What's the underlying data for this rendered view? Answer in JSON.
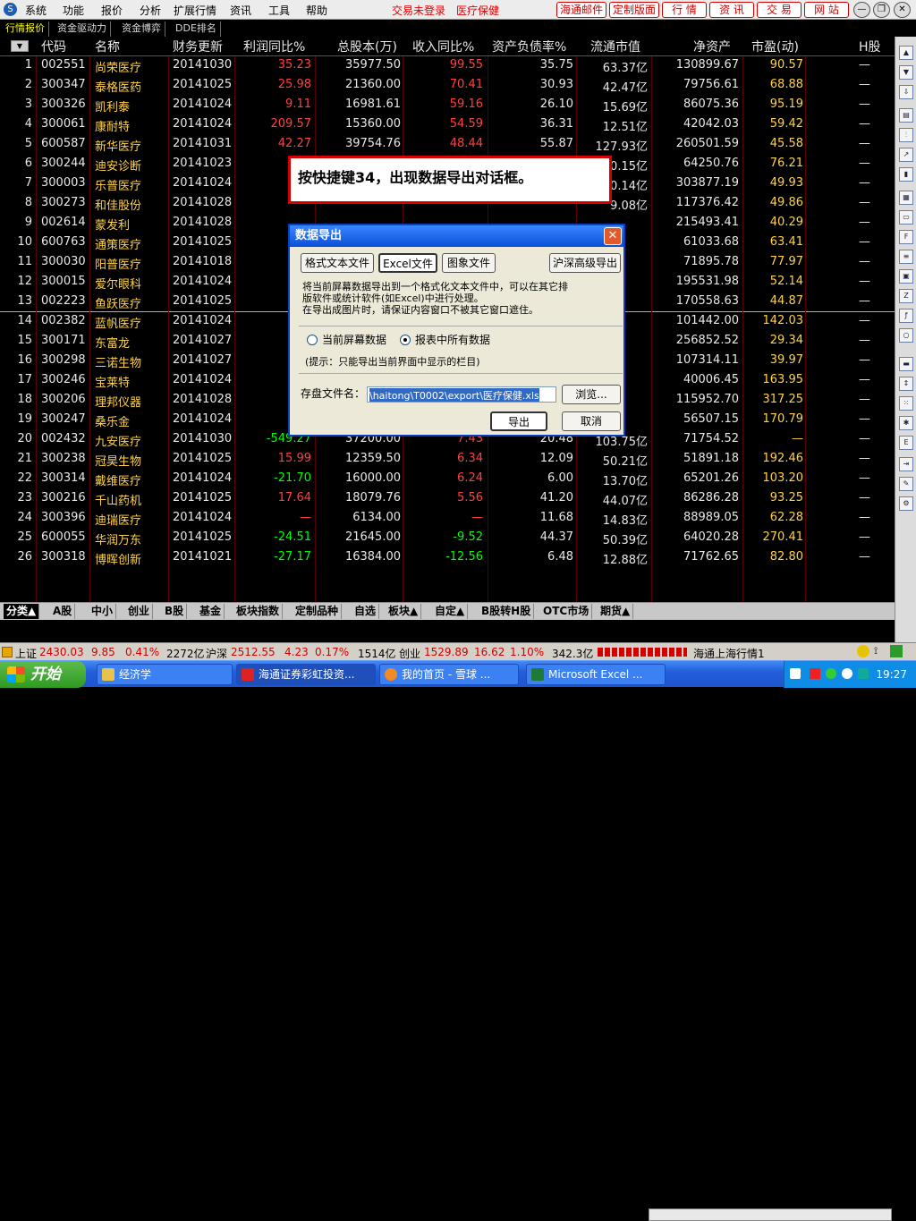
{
  "menubar": {
    "logo": "S",
    "items": [
      "系统",
      "功能",
      "报价",
      "分析",
      "扩展行情",
      "资讯",
      "工具",
      "帮助"
    ],
    "login_status": "交易未登录",
    "sector": "医疗保健",
    "toolbar": [
      "海通邮件",
      "定制版面",
      "行 情",
      "资 讯",
      "交 易",
      "网 站"
    ]
  },
  "subtabs": [
    "行情报价",
    "资金驱动力",
    "资金博弈",
    "DDE排名"
  ],
  "columns": [
    "代码",
    "名称",
    "财务更新",
    "利润同比%",
    "总股本(万)",
    "收入同比%",
    "资产负债率%",
    "流通市值",
    "净资产",
    "市盈(动)",
    "H股"
  ],
  "rows": [
    [
      "1",
      "002551",
      "尚荣医疗",
      "20141030",
      "35.23",
      "35977.50",
      "99.55",
      "35.75",
      "63.37亿",
      "130899.67",
      "90.57",
      "—"
    ],
    [
      "2",
      "300347",
      "泰格医药",
      "20141025",
      "25.98",
      "21360.00",
      "70.41",
      "30.93",
      "42.47亿",
      "79756.61",
      "68.88",
      "—"
    ],
    [
      "3",
      "300326",
      "凯利泰",
      "20141024",
      "9.11",
      "16981.61",
      "59.16",
      "26.10",
      "15.69亿",
      "86075.36",
      "95.19",
      "—"
    ],
    [
      "4",
      "300061",
      "康耐特",
      "20141024",
      "209.57",
      "15360.00",
      "54.59",
      "36.31",
      "12.51亿",
      "42042.03",
      "59.42",
      "—"
    ],
    [
      "5",
      "600587",
      "新华医疗",
      "20141031",
      "42.27",
      "39754.76",
      "48.44",
      "55.87",
      "127.93亿",
      "260501.59",
      "45.58",
      "—"
    ],
    [
      "6",
      "300244",
      "迪安诊断",
      "20141023",
      "",
      "",
      "",
      "",
      "0.15亿",
      "64250.76",
      "76.21",
      "—"
    ],
    [
      "7",
      "300003",
      "乐普医疗",
      "20141024",
      "",
      "",
      "",
      "",
      "0.14亿",
      "303877.19",
      "49.93",
      "—"
    ],
    [
      "8",
      "300273",
      "和佳股份",
      "20141028",
      "",
      "",
      "",
      "",
      "9.08亿",
      "117376.42",
      "49.86",
      "—"
    ],
    [
      "9",
      "002614",
      "蒙发利",
      "20141028",
      "",
      "",
      "",
      "",
      "",
      "215493.41",
      "40.29",
      "—"
    ],
    [
      "10",
      "600763",
      "通策医疗",
      "20141025",
      "",
      "",
      "",
      "",
      "",
      "61033.68",
      "63.41",
      "—"
    ],
    [
      "11",
      "300030",
      "阳普医疗",
      "20141018",
      "",
      "",
      "",
      "",
      "",
      "71895.78",
      "77.97",
      "—"
    ],
    [
      "12",
      "300015",
      "爱尔眼科",
      "20141024",
      "",
      "",
      "",
      "",
      "",
      "195531.98",
      "52.14",
      "—"
    ],
    [
      "13",
      "002223",
      "鱼跃医疗",
      "20141025",
      "",
      "",
      "",
      "",
      "",
      "170558.63",
      "44.87",
      "—"
    ],
    [
      "14",
      "002382",
      "蓝帆医疗",
      "20141024",
      "",
      "",
      "",
      "",
      "",
      "101442.00",
      "142.03",
      "—"
    ],
    [
      "15",
      "300171",
      "东富龙",
      "20141027",
      "",
      "",
      "",
      "",
      "",
      "256852.52",
      "29.34",
      "—"
    ],
    [
      "16",
      "300298",
      "三诺生物",
      "20141027",
      "",
      "",
      "",
      "",
      "",
      "107314.11",
      "39.97",
      "—"
    ],
    [
      "17",
      "300246",
      "宝莱特",
      "20141024",
      "",
      "",
      "",
      "",
      "",
      "40006.45",
      "163.95",
      "—"
    ],
    [
      "18",
      "300206",
      "理邦仪器",
      "20141028",
      "",
      "",
      "",
      "",
      "",
      "115952.70",
      "317.25",
      "—"
    ],
    [
      "19",
      "300247",
      "桑乐金",
      "20141024",
      "",
      "",
      "",
      "",
      "",
      "56507.15",
      "170.79",
      "—"
    ],
    [
      "20",
      "002432",
      "九安医疗",
      "20141030",
      "-549.27",
      "37200.00",
      "7.43",
      "20.48",
      "103.75亿",
      "71754.52",
      "—",
      "—"
    ],
    [
      "21",
      "300238",
      "冠昊生物",
      "20141025",
      "15.99",
      "12359.50",
      "6.34",
      "12.09",
      "50.21亿",
      "51891.18",
      "192.46",
      "—"
    ],
    [
      "22",
      "300314",
      "戴维医疗",
      "20141024",
      "-21.70",
      "16000.00",
      "6.24",
      "6.00",
      "13.70亿",
      "65201.26",
      "103.20",
      "—"
    ],
    [
      "23",
      "300216",
      "千山药机",
      "20141025",
      "17.64",
      "18079.76",
      "5.56",
      "41.20",
      "44.07亿",
      "86286.28",
      "93.25",
      "—"
    ],
    [
      "24",
      "300396",
      "迪瑞医疗",
      "20141024",
      "—",
      "6134.00",
      "—",
      "11.68",
      "14.83亿",
      "88989.05",
      "62.28",
      "—"
    ],
    [
      "25",
      "600055",
      "华润万东",
      "20141025",
      "-24.51",
      "21645.00",
      "-9.52",
      "44.37",
      "50.39亿",
      "64020.28",
      "270.41",
      "—"
    ],
    [
      "26",
      "300318",
      "博晖创新",
      "20141021",
      "-27.17",
      "16384.00",
      "-12.56",
      "6.48",
      "12.88亿",
      "71762.65",
      "82.80",
      "—"
    ]
  ],
  "bottom_tabs": [
    "分类▲",
    "A股",
    "中小",
    "创业",
    "B股",
    "基金",
    "板块指数",
    "定制品种",
    "自选",
    "板块▲",
    "自定▲",
    "B股转H股",
    "OTC市场",
    "期货▲"
  ],
  "status": {
    "sh_label": "上证",
    "sh_value": "2430.03",
    "sh_change": "9.85",
    "sh_pct": "0.41%",
    "sh_amount": "2272亿",
    "hs_label": "沪深",
    "hs_value": "2512.55",
    "hs_change": "4.23",
    "hs_pct": "0.17%",
    "hs_amount": "1514亿",
    "cy_label": "创业",
    "cy_value": "1529.89",
    "cy_change": "16.62",
    "cy_pct": "1.10%",
    "cy_amount": "342.3亿",
    "feed": "海通上海行情1"
  },
  "callout": "按快捷键34，出现数据导出对话框。",
  "dialog": {
    "title": "数据导出",
    "tabs": [
      "格式文本文件",
      "Excel文件",
      "图象文件"
    ],
    "advanced_button": "沪深高级导出",
    "desc1": "将当前屏幕数据导出到一个格式化文本文件中，可以在其它排",
    "desc2": "版软件或统计软件(如Excel)中进行处理。",
    "desc3": "在导出成图片时，请保证内容窗口不被其它窗口遮住。",
    "radio1": "当前屏幕数据",
    "radio2": "报表中所有数据",
    "hint": "(提示：只能导出当前界面中显示的栏目)",
    "file_label": "存盘文件名：",
    "file_value": "\\haitong\\T0002\\export\\医疗保健.xls",
    "browse": "浏览...",
    "export": "导出",
    "cancel": "取消"
  },
  "taskbar": {
    "start": "开始",
    "tasks": [
      "经济学",
      "海通证券彩虹投资...",
      "我的首页 - 雪球 ...",
      "Microsoft Excel ..."
    ],
    "clock": "19:27"
  }
}
